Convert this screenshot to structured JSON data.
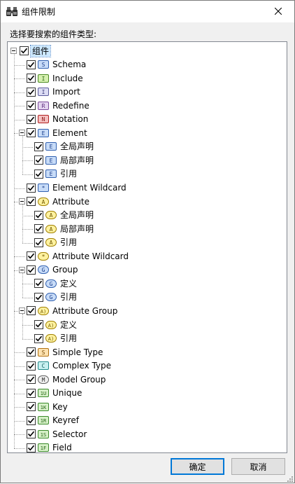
{
  "window": {
    "title": "组件限制"
  },
  "prompt": "选择要搜索的组件类型:",
  "tree": {
    "root": {
      "label": "组件",
      "checked": true
    },
    "items": [
      {
        "key": "schema",
        "label": "Schema",
        "icon": "S",
        "bg": "#c8dcf8",
        "border": "#3060b0",
        "fg": "#1a3e8c"
      },
      {
        "key": "include",
        "label": "Include",
        "icon": "I",
        "bg": "#d6f0b0",
        "border": "#4a8a20",
        "fg": "#2a6a10"
      },
      {
        "key": "import",
        "label": "Import",
        "icon": "I",
        "bg": "#dcdcf4",
        "border": "#5a5a9a",
        "fg": "#3a3a7a"
      },
      {
        "key": "redefine",
        "label": "Redefine",
        "icon": "R",
        "bg": "#e4d4f0",
        "border": "#7a4a9a",
        "fg": "#5a2a7a"
      },
      {
        "key": "notation",
        "label": "Notation",
        "icon": "N",
        "bg": "#f4c0c0",
        "border": "#b02020",
        "fg": "#8a1010"
      },
      {
        "key": "element",
        "label": "Element",
        "icon": "E",
        "bg": "#c8dcf8",
        "border": "#3060b0",
        "fg": "#1a3e8c",
        "children": [
          {
            "key": "element-global",
            "label": "全局声明",
            "icon": "E"
          },
          {
            "key": "element-local",
            "label": "局部声明",
            "icon": "E"
          },
          {
            "key": "element-ref",
            "label": "引用",
            "icon": "E"
          }
        ]
      },
      {
        "key": "element-wildcard",
        "label": "Element Wildcard",
        "icon": "*",
        "bg": "#c8dcf8",
        "border": "#3060b0",
        "fg": "#1a3e8c"
      },
      {
        "key": "attribute",
        "label": "Attribute",
        "icon": "A",
        "bg": "#fff2a0",
        "border": "#a08000",
        "fg": "#705800",
        "children": [
          {
            "key": "attribute-global",
            "label": "全局声明",
            "icon": "A"
          },
          {
            "key": "attribute-local",
            "label": "局部声明",
            "icon": "A"
          },
          {
            "key": "attribute-ref",
            "label": "引用",
            "icon": "A"
          }
        ]
      },
      {
        "key": "attribute-wildcard",
        "label": "Attribute Wildcard",
        "icon": "*",
        "bg": "#fff2a0",
        "border": "#a08000",
        "fg": "#705800"
      },
      {
        "key": "group",
        "label": "Group",
        "icon": "G",
        "bg": "#c8dcf8",
        "border": "#3060b0",
        "fg": "#1a3e8c",
        "children": [
          {
            "key": "group-def",
            "label": "定义",
            "icon": "G"
          },
          {
            "key": "group-ref",
            "label": "引用",
            "icon": "G"
          }
        ]
      },
      {
        "key": "attribute-group",
        "label": "Attribute Group",
        "icon": "A)",
        "bg": "#fff2a0",
        "border": "#a08000",
        "fg": "#705800",
        "children": [
          {
            "key": "attrgroup-def",
            "label": "定义",
            "icon": "A)"
          },
          {
            "key": "attrgroup-ref",
            "label": "引用",
            "icon": "A)"
          }
        ]
      },
      {
        "key": "simple-type",
        "label": "Simple Type",
        "icon": "S",
        "bg": "#fde2b0",
        "border": "#b07010",
        "fg": "#7a4a00"
      },
      {
        "key": "complex-type",
        "label": "Complex Type",
        "icon": "C",
        "bg": "#c8f0f0",
        "border": "#208a8a",
        "fg": "#106060"
      },
      {
        "key": "model-group",
        "label": "Model Group",
        "icon": "M",
        "bg": "#eeeeee",
        "border": "#606060",
        "fg": "#303030"
      },
      {
        "key": "unique",
        "label": "Unique",
        "icon": "1U",
        "bg": "#d6f0c8",
        "border": "#3a8a2a",
        "fg": "#206010"
      },
      {
        "key": "key",
        "label": "Key",
        "icon": "1K",
        "bg": "#d6f0c8",
        "border": "#3a8a2a",
        "fg": "#206010"
      },
      {
        "key": "keyref",
        "label": "Keyref",
        "icon": "1R",
        "bg": "#d6f0c8",
        "border": "#3a8a2a",
        "fg": "#206010"
      },
      {
        "key": "selector",
        "label": "Selector",
        "icon": "1S",
        "bg": "#d6f0c8",
        "border": "#3a8a2a",
        "fg": "#206010"
      },
      {
        "key": "field",
        "label": "Field",
        "icon": "1F",
        "bg": "#d6f0c8",
        "border": "#3a8a2a",
        "fg": "#206010"
      }
    ]
  },
  "buttons": {
    "ok": "确定",
    "cancel": "取消"
  }
}
